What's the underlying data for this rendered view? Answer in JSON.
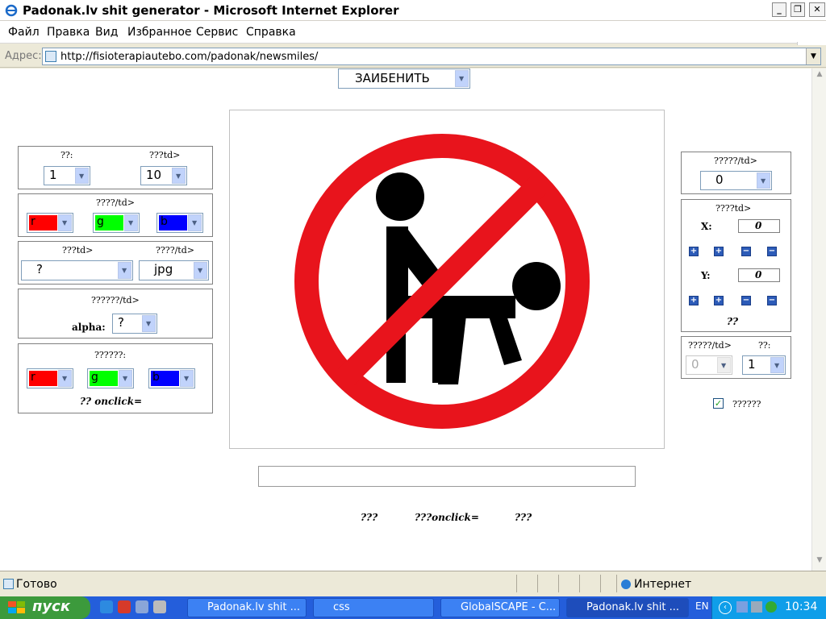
{
  "window": {
    "title": "Padonak.lv shit generator - Microsoft Internet Explorer",
    "minimize": "_",
    "maximize": "❐",
    "close": "✕"
  },
  "menu": [
    "Файл",
    "Правка",
    "Вид",
    "Избранное",
    "Сервис",
    "Справка"
  ],
  "address": {
    "label": "Адрес:",
    "url": "http://fisioterapiautebo.com/padonak/newsmiles/"
  },
  "top_select": {
    "value": "ЗАИБЕНИТЬ"
  },
  "panel_size": {
    "label_a": "??:",
    "label_b": "???td>",
    "value_a": "1",
    "value_b": "10"
  },
  "panel_color": {
    "label": "????/td>",
    "r": "r",
    "g": "g",
    "b": "b"
  },
  "panel_format": {
    "label_a": "???td>",
    "label_b": "????/td>",
    "value_a": "?",
    "value_b": "jpg"
  },
  "panel_alpha": {
    "label": "??????/td>",
    "alpha_label": "alpha:",
    "value": "?"
  },
  "panel_bg": {
    "label": "??????:",
    "r": "r",
    "g": "g",
    "b": "b",
    "note": "?? onclick="
  },
  "right_top": {
    "label": "?????/td>",
    "value": "0"
  },
  "right_pos": {
    "label": "????td>",
    "x_label": "X:",
    "x_value": "0",
    "y_label": "Y:",
    "y_value": "0",
    "footer": "??"
  },
  "right_bottom": {
    "label_a": "?????/td>",
    "label_b": "??:",
    "value_a": "0",
    "value_b": "1"
  },
  "checkbox": {
    "label": "??????",
    "checked": true
  },
  "bottom_links": [
    "???",
    "???onclick=",
    "???"
  ],
  "status": {
    "text": "Готово",
    "zone": "Интернет"
  },
  "taskbar": {
    "start": "пуск",
    "tasks": [
      "Padonak.lv shit ...",
      "css",
      "GlobalSCAPE - C...",
      "Padonak.lv shit ..."
    ],
    "lang": "EN",
    "time": "10:34"
  },
  "colors": {
    "red": "#ff0000",
    "green": "#00ff00",
    "blue": "#0000ff",
    "sign_red": "#e8141c"
  }
}
